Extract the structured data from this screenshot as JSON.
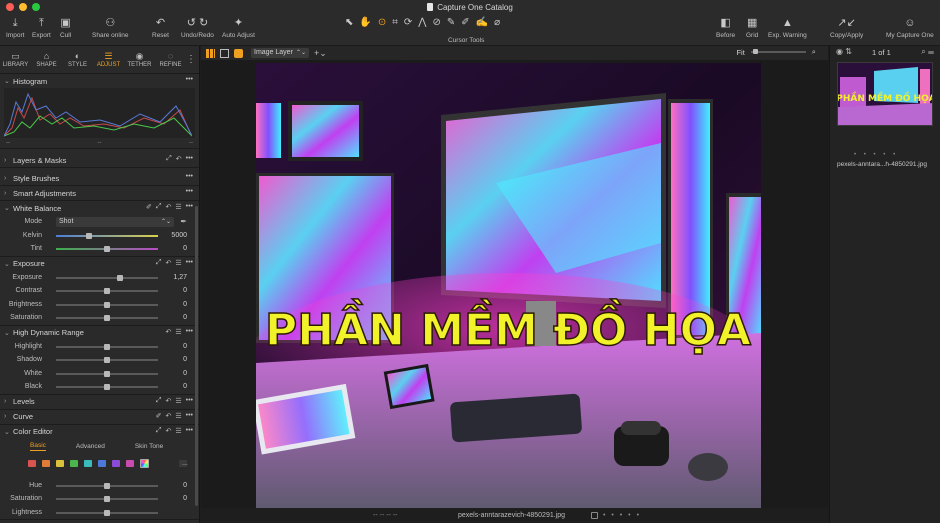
{
  "window": {
    "title": "Capture One Catalog"
  },
  "toolbar": {
    "left": [
      {
        "label": "Import",
        "icon": "import-icon",
        "glyph": "⤓"
      },
      {
        "label": "Export",
        "icon": "export-icon",
        "glyph": "⤒"
      },
      {
        "label": "Cull",
        "icon": "cull-icon",
        "glyph": "▣"
      },
      {
        "label": "Share online",
        "icon": "people-icon",
        "glyph": "👥"
      },
      {
        "label": "Reset",
        "icon": "reset-icon",
        "glyph": "↶"
      },
      {
        "label": "Undo/Redo",
        "icon": "undo-icon",
        "glyph": "↺ ↻"
      },
      {
        "label": "Auto Adjust",
        "icon": "magic-wand-icon",
        "glyph": "✦"
      }
    ],
    "cursor_tools_label": "Cursor Tools",
    "right": [
      {
        "label": "Before",
        "icon": "before-icon",
        "glyph": "◧"
      },
      {
        "label": "Grid",
        "icon": "grid-icon",
        "glyph": "▦"
      },
      {
        "label": "Exp. Warning",
        "icon": "warning-icon",
        "glyph": "▲"
      },
      {
        "label": "Copy/Apply",
        "icon": "copy-apply-icon",
        "glyph": "↗↙"
      },
      {
        "label": "My Capture One",
        "icon": "account-icon",
        "glyph": "👤"
      }
    ]
  },
  "tool_tabs": [
    {
      "label": "LIBRARY",
      "icon": "folder-icon",
      "glyph": "▭"
    },
    {
      "label": "SHAPE",
      "icon": "shape-icon",
      "glyph": "⌂"
    },
    {
      "label": "STYLE",
      "icon": "style-icon",
      "glyph": "◐"
    },
    {
      "label": "ADJUST",
      "icon": "adjust-icon",
      "glyph": "☰",
      "active": true
    },
    {
      "label": "TETHER",
      "icon": "camera-icon",
      "glyph": "◉"
    },
    {
      "label": "REFINE",
      "icon": "refine-icon",
      "glyph": "◌"
    }
  ],
  "histogram": {
    "title": "Histogram",
    "left_value": "--",
    "mid_value": "--",
    "right_value": "--"
  },
  "sections": {
    "layers": "Layers & Masks",
    "style_brushes": "Style Brushes",
    "smart_adjustments": "Smart Adjustments",
    "levels": "Levels",
    "curve": "Curve"
  },
  "white_balance": {
    "title": "White Balance",
    "mode_label": "Mode",
    "mode_value": "Shot",
    "kelvin_label": "Kelvin",
    "kelvin_value": "5000",
    "kelvin_level": 0.32,
    "tint_label": "Tint",
    "tint_value": "0",
    "tint_level": 0.5
  },
  "exposure": {
    "title": "Exposure",
    "sliders": [
      {
        "label": "Exposure",
        "value": "1,27",
        "level": 0.63
      },
      {
        "label": "Contrast",
        "value": "0",
        "level": 0.5
      },
      {
        "label": "Brightness",
        "value": "0",
        "level": 0.5
      },
      {
        "label": "Saturation",
        "value": "0",
        "level": 0.5
      }
    ]
  },
  "hdr": {
    "title": "High Dynamic Range",
    "sliders": [
      {
        "label": "Highlight",
        "value": "0",
        "level": 0.5
      },
      {
        "label": "Shadow",
        "value": "0",
        "level": 0.5
      },
      {
        "label": "White",
        "value": "0",
        "level": 0.5
      },
      {
        "label": "Black",
        "value": "0",
        "level": 0.5
      }
    ]
  },
  "color_editor": {
    "title": "Color Editor",
    "tabs": [
      "Basic",
      "Advanced",
      "Skin Tone"
    ],
    "swatch_colors": [
      "#d9534f",
      "#e07b39",
      "#d9c13b",
      "#4bb64b",
      "#3bbcbc",
      "#4b78d9",
      "#8a4bd9",
      "#c94bb0"
    ],
    "more_label": "...",
    "sliders": [
      {
        "label": "Hue",
        "value": "0",
        "level": 0.5
      },
      {
        "label": "Saturation",
        "value": "0",
        "level": 0.5
      },
      {
        "label": "Lightness",
        "value": "",
        "level": 0.5
      }
    ]
  },
  "viewer": {
    "layer_select": "Image Layer",
    "zoom": "Fit",
    "photo_text": "PHẦN MỀM ĐỒ HỌA",
    "filename": "pexels-anntarazevich-4850291.jpg",
    "left_dots": "--    --    --    --"
  },
  "browser": {
    "count": "1 of 1",
    "thumb_name": "pexels-anntara...h-4850291.jpg",
    "thumb_text": "PHẦN MỀM ĐỒ HỌA",
    "rating_dots": "• • • • •"
  }
}
